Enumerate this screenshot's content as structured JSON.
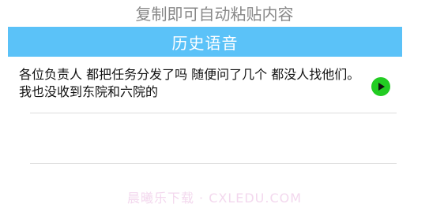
{
  "top_hint": "复制即可自动粘贴内容",
  "header": {
    "title": "历史语音"
  },
  "history": {
    "items": [
      {
        "text": "各位负责人  都把任务分发了吗   随便问了几个  都没人找他们。  我也没收到东院和六院的",
        "play_icon": "play-icon"
      }
    ]
  },
  "watermark": "晨曦乐下载 · CXLEDU.COM",
  "colors": {
    "header_bg": "#5bc2f8",
    "header_text": "#ffffff",
    "play_button": "#22cc22",
    "divider": "#dddddd"
  }
}
